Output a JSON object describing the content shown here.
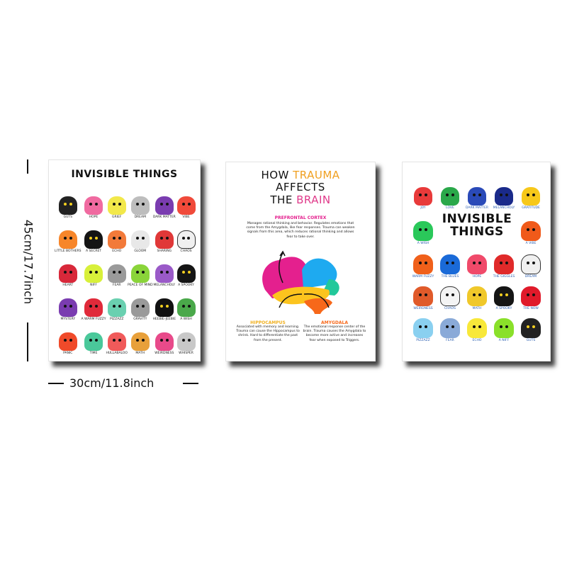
{
  "dimensions": {
    "height": "45cm/17.7inch",
    "width": "30cm/11.8inch"
  },
  "poster1": {
    "title": "INVISIBLE THINGS",
    "items": [
      {
        "label": "GUTS",
        "color": "#222222"
      },
      {
        "label": "HOPE",
        "color": "#f06aa0"
      },
      {
        "label": "GRIEF",
        "color": "#f2e84a"
      },
      {
        "label": "DREAM",
        "color": "#bdbdbd"
      },
      {
        "label": "DARK MATTER",
        "color": "#7a3cb0"
      },
      {
        "label": "VIBE",
        "color": "#f04a3a"
      },
      {
        "label": "LITTLE BOTHERS",
        "color": "#f7862a"
      },
      {
        "label": "A SECRET",
        "color": "#151515"
      },
      {
        "label": "ECHO",
        "color": "#f27a3a"
      },
      {
        "label": "GLOOM",
        "color": "#e8e8e8"
      },
      {
        "label": "SHARING",
        "color": "#e03838"
      },
      {
        "label": "CHAOS",
        "color": "#f0f0f0"
      },
      {
        "label": "HEART",
        "color": "#d8283a"
      },
      {
        "label": "NIFF",
        "color": "#d8f03a"
      },
      {
        "label": "FEAR",
        "color": "#9a9a9a"
      },
      {
        "label": "PEACE OF MIND",
        "color": "#8ad43a"
      },
      {
        "label": "MELANCHOLY",
        "color": "#9a5ac8"
      },
      {
        "label": "A SPOOKY",
        "color": "#151515"
      },
      {
        "label": "MYSTERY",
        "color": "#7a3cb0"
      },
      {
        "label": "A WARM FUZZY",
        "color": "#e02a3a"
      },
      {
        "label": "PIZZAZZ",
        "color": "#6ad0b0"
      },
      {
        "label": "GRAVITY",
        "color": "#9a9a9a"
      },
      {
        "label": "HEEBIE-JEEBIE",
        "color": "#111111"
      },
      {
        "label": "A WISH",
        "color": "#4aa84a"
      },
      {
        "label": "PANIC",
        "color": "#f04a2a"
      },
      {
        "label": "TIME",
        "color": "#4ac89a"
      },
      {
        "label": "HULLABALOO",
        "color": "#f05a5a"
      },
      {
        "label": "MATH",
        "color": "#e8a03a"
      },
      {
        "label": "WEIRDNESS",
        "color": "#e84a8a"
      },
      {
        "label": "WHISPER",
        "color": "#c8c8c8"
      }
    ]
  },
  "poster2": {
    "title_parts": [
      "HOW ",
      "TRAUMA",
      "AFFECTS",
      "THE ",
      "BRAIN"
    ],
    "prefrontal": {
      "heading": "PREFRONTAL CORTEX",
      "text": "Manages rational thinking and behavior. Regulates emotions that come from the Amygdala, like fear responses. Trauma can weaken signals from this area, which reduces rational thinking and allows fear to take over."
    },
    "hippocampus": {
      "heading": "HIPPOCAMPUS",
      "text": "Associated with memory and learning. Trauma can cause the Hippocampus to shrink. Hard to differentiate the past from the present."
    },
    "amygdala": {
      "heading": "AMYGDALA",
      "text": "The emotional response center of the brain. Trauma causes the Amygdala to become more active and increases fear when exposed to Triggers."
    },
    "colors": {
      "pink": "#e4208e",
      "blue": "#1eaaf0",
      "teal": "#22c89a",
      "yellow": "#fcc41e",
      "orange": "#f7681a"
    }
  },
  "poster3": {
    "title_line1": "INVISIBLE",
    "title_line2": "THINGS",
    "row1": [
      {
        "label": "JOY",
        "color": "#e83a3a"
      },
      {
        "label": "LOVE",
        "color": "#2aa84a"
      },
      {
        "label": "DARK MATTER",
        "color": "#2a4ab8"
      },
      {
        "label": "MELANCHOLY",
        "color": "#1a2a8a"
      },
      {
        "label": "GRATITUDE",
        "color": "#f7c81a"
      }
    ],
    "row2": [
      {
        "label": "A WISH",
        "color": "#2ac85a"
      },
      {
        "label": "A VIBE",
        "color": "#f05a1a"
      }
    ],
    "rest": [
      {
        "label": "WARM FUZZY",
        "color": "#f0601a"
      },
      {
        "label": "THE BLUES",
        "color": "#1a6ad8"
      },
      {
        "label": "HOPE",
        "color": "#f04a6a"
      },
      {
        "label": "THE GIGGLES",
        "color": "#e02a2a"
      },
      {
        "label": "DREAM",
        "color": "#f0f0f0"
      },
      {
        "label": "WEIRDNESS",
        "color": "#e05a2a"
      },
      {
        "label": "CHAOS",
        "color": "#f4f4f4"
      },
      {
        "label": "MATH",
        "color": "#f0c82a"
      },
      {
        "label": "A SPOOKY",
        "color": "#151515"
      },
      {
        "label": "THE NOW",
        "color": "#e01a2a"
      },
      {
        "label": "PIZZAZZ",
        "color": "#8ad0f0"
      },
      {
        "label": "FEAR",
        "color": "#8aaad8"
      },
      {
        "label": "ECHO",
        "color": "#f8e83a"
      },
      {
        "label": "A NIFF",
        "color": "#8ae02a"
      },
      {
        "label": "GUTS",
        "color": "#222222"
      }
    ]
  }
}
